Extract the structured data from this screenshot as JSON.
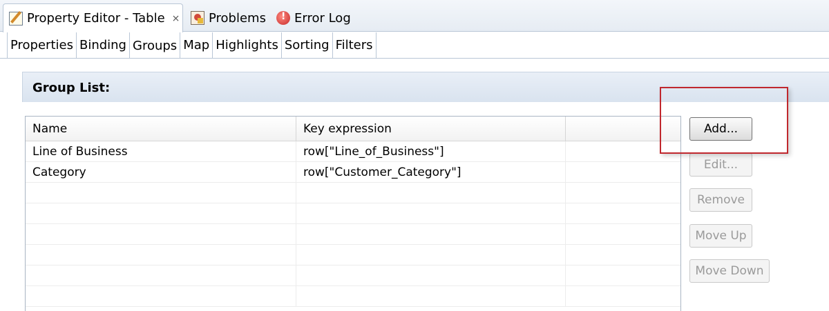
{
  "view_tabs": [
    {
      "label": "Property Editor - Table",
      "icon": "edit-icon",
      "active": true,
      "closable": true
    },
    {
      "label": "Problems",
      "icon": "problems-icon",
      "active": false
    },
    {
      "label": "Error Log",
      "icon": "error-log-icon",
      "active": false
    }
  ],
  "close_glyph": "⨯",
  "sub_tabs": [
    "Properties",
    "Binding",
    "Groups",
    "Map",
    "Highlights",
    "Sorting",
    "Filters"
  ],
  "active_sub_tab": "Groups",
  "section": {
    "title": "Group List:"
  },
  "table": {
    "columns": [
      "Name",
      "Key expression",
      ""
    ],
    "rows": [
      [
        "Line of Business",
        "row[\"Line_of_Business\"]",
        ""
      ],
      [
        "Category",
        "row[\"Customer_Category\"]",
        ""
      ]
    ]
  },
  "buttons": {
    "add": "Add...",
    "edit": "Edit...",
    "remove": "Remove",
    "move_up": "Move Up",
    "move_down": "Move Down"
  },
  "colors": {
    "highlight": "#c0272d",
    "header_blue": "#dde6f1"
  }
}
